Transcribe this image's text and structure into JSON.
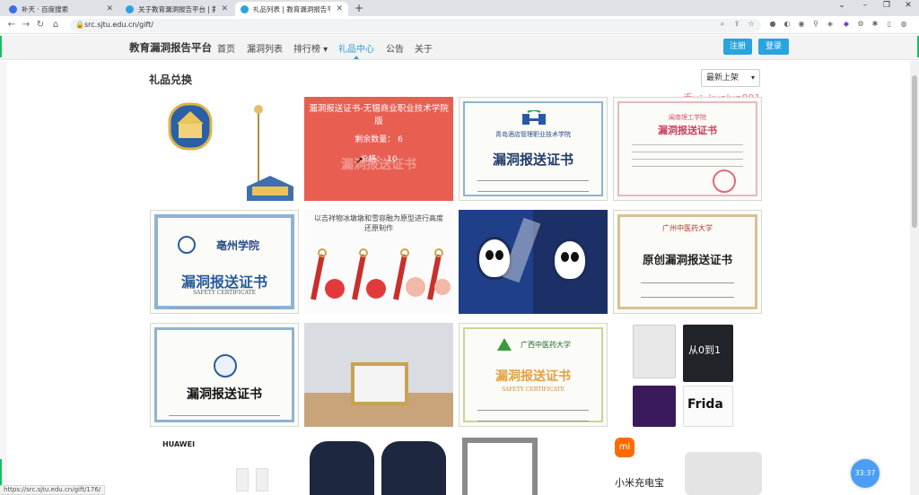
{
  "browser": {
    "tabs": [
      {
        "title": "补天 · 百度搜索",
        "favicon_color": "#3a6ee8"
      },
      {
        "title": "关于教育漏洞报告平台 | 教育漏...",
        "favicon_color": "#2aa4df"
      },
      {
        "title": "礼品列表 | 教育漏洞报告平台",
        "favicon_color": "#2aa4df"
      }
    ],
    "url": "src.sjtu.edu.cn/gift/",
    "status_url": "https://src.sjtu.edu.cn/gift/176/"
  },
  "site": {
    "brand": "教育漏洞报告平台",
    "nav": [
      {
        "label": "首页"
      },
      {
        "label": "漏洞列表"
      },
      {
        "label": "排行榜 ▾"
      },
      {
        "label": "礼品中心"
      },
      {
        "label": "公告"
      },
      {
        "label": "关于"
      }
    ],
    "register_label": "注册",
    "login_label": "登录"
  },
  "page": {
    "title": "礼品兑换",
    "sort_selected": "最新上架",
    "watermark": "一手v：kunlun991",
    "hover_gift": {
      "name": "漏洞报送证书-无锡商业职业技术学院版",
      "stock": "剩余数量：  6",
      "price": "价格：  10"
    },
    "gifts": [
      {
        "caption": ""
      },
      {
        "caption": "漏洞报送证书"
      },
      {
        "caption": "漏洞报送证书",
        "school": "青岛酒店管理职业技术学院"
      },
      {
        "caption": "漏洞报送证书",
        "school": "闽南理工学院"
      },
      {
        "caption": "漏洞报送证书",
        "school": "亳州学院",
        "sub": "SAFETY CERTIFICATE"
      },
      {
        "caption": "以吉祥物冰墩墩和雪容融为原型进行高度还原制作"
      },
      {
        "caption": ""
      },
      {
        "caption": "原创漏洞报送证书",
        "school": "广州中医药大学"
      },
      {
        "caption": "漏洞报送证书"
      },
      {
        "caption": ""
      },
      {
        "caption": "漏洞报送证书",
        "school": "广西中医药大学",
        "sub": "SAFETY CERTIFICATE"
      },
      {
        "caption": "从0到1",
        "extra": "Frida"
      },
      {
        "caption": "HUAWEI"
      },
      {
        "caption": ""
      },
      {
        "caption": ""
      },
      {
        "caption": "小米充电宝"
      }
    ]
  },
  "timer": "33:37"
}
